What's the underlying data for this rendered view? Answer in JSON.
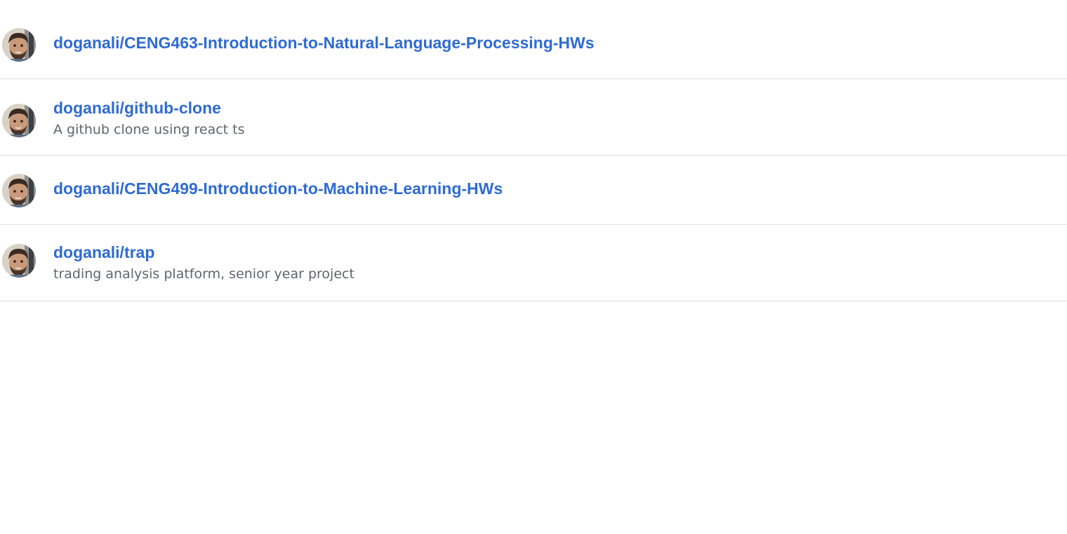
{
  "repositories": [
    {
      "owner_avatar": "user-avatar",
      "name": "doganali/CENG463-Introduction-to-Natural-Language-Processing-HWs",
      "description": ""
    },
    {
      "owner_avatar": "user-avatar",
      "name": "doganali/github-clone",
      "description": "A github clone using react ts"
    },
    {
      "owner_avatar": "user-avatar",
      "name": "doganali/CENG499-Introduction-to-Machine-Learning-HWs",
      "description": ""
    },
    {
      "owner_avatar": "user-avatar",
      "name": "doganali/trap",
      "description": "trading analysis platform, senior year project"
    }
  ],
  "colors": {
    "link": "#2f6bd1",
    "description": "#60656d",
    "divider": "#dcdee1"
  }
}
